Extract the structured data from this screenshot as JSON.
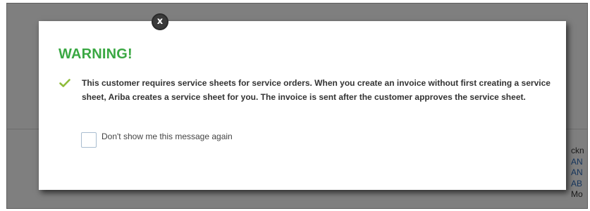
{
  "background": {
    "snippet_lines": [
      "ckn",
      "AN",
      "AN",
      "AB",
      "Mo"
    ]
  },
  "dialog": {
    "close_glyph": "x",
    "title": "WARNING!",
    "icon": "checkmark-icon",
    "message": "This customer requires service sheets for service orders. When you create an invoice without first creating a service sheet, Ariba creates a service sheet for you. The invoice is sent after the customer approves the service sheet.",
    "checkbox_label": "Don't show me this message again",
    "checkbox_checked": false
  },
  "colors": {
    "title": "#3aa843",
    "checkmark": "#8fbc3b",
    "overlay": "#7f7f7f"
  }
}
